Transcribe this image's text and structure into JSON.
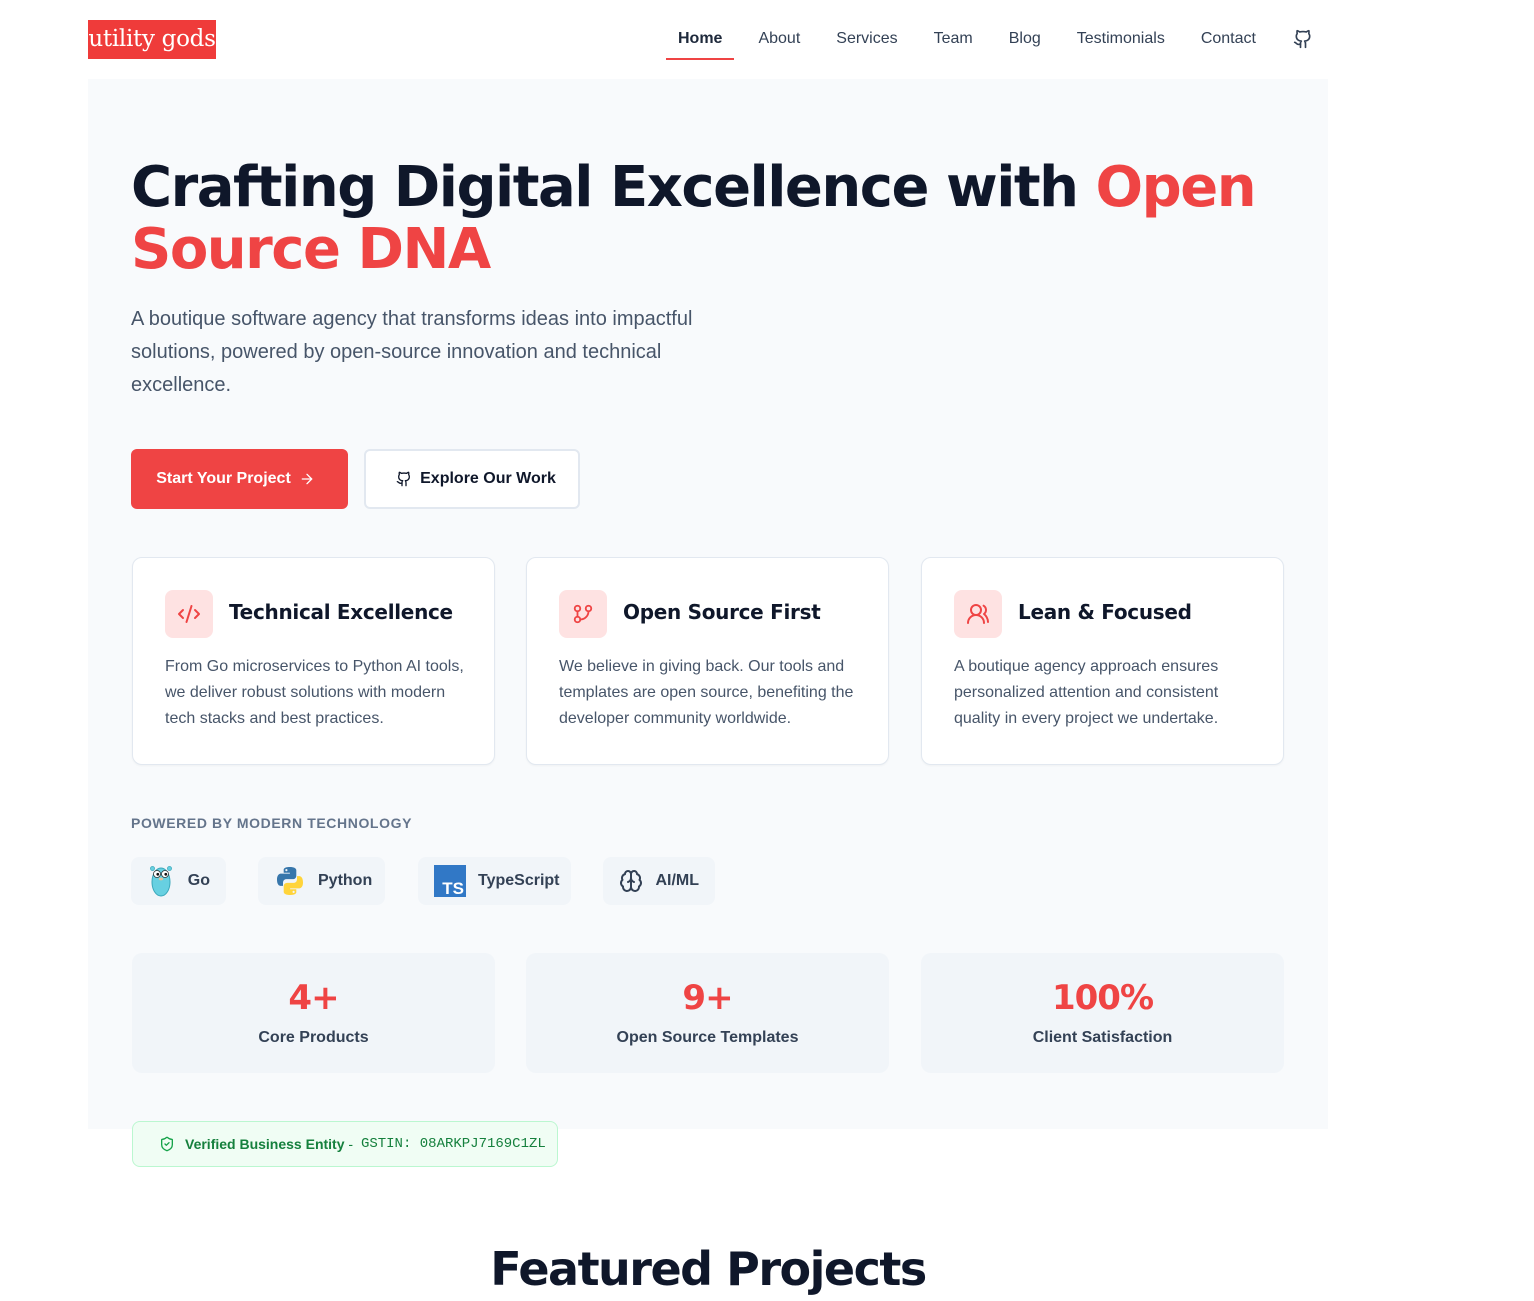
{
  "brand": {
    "logo_text": "utility gods",
    "accent_color": "#ef4444"
  },
  "nav": {
    "items": [
      {
        "label": "Home",
        "active": true
      },
      {
        "label": "About"
      },
      {
        "label": "Services"
      },
      {
        "label": "Team"
      },
      {
        "label": "Blog"
      },
      {
        "label": "Testimonials"
      },
      {
        "label": "Contact"
      }
    ],
    "github_icon": "github-icon"
  },
  "hero": {
    "title_main": "Crafting Digital Excellence with ",
    "title_accent": "Open Source DNA",
    "subtitle": "A boutique software agency that transforms ideas into impactful solutions, powered by open-source innovation and technical excellence.",
    "cta_primary": "Start Your Project",
    "cta_secondary": "Explore Our Work"
  },
  "features": [
    {
      "icon": "code-icon",
      "title": "Technical Excellence",
      "desc": "From Go microservices to Python AI tools, we deliver robust solutions with modern tech stacks and best practices."
    },
    {
      "icon": "git-branch-icon",
      "title": "Open Source First",
      "desc": "We believe in giving back. Our tools and templates are open source, benefiting the developer community worldwide."
    },
    {
      "icon": "users-icon",
      "title": "Lean & Focused",
      "desc": "A boutique agency approach ensures personalized attention and consistent quality in every project we undertake."
    }
  ],
  "tech": {
    "label": "POWERED BY MODERN TECHNOLOGY",
    "items": [
      {
        "label": "Go",
        "icon": "gopher-icon"
      },
      {
        "label": "Python",
        "icon": "python-icon"
      },
      {
        "label": "TypeScript",
        "icon": "typescript-icon"
      },
      {
        "label": "AI/ML",
        "icon": "brain-icon"
      }
    ]
  },
  "stats": [
    {
      "value": "4+",
      "label": "Core Products"
    },
    {
      "value": "9+",
      "label": "Open Source Templates"
    },
    {
      "value": "100%",
      "label": "Client Satisfaction"
    }
  ],
  "verify": {
    "label": "Verified Business Entity",
    "separator": " - ",
    "gstin": "GSTIN: 08ARKPJ7169C1ZL"
  },
  "featured": {
    "title": "Featured Projects"
  }
}
